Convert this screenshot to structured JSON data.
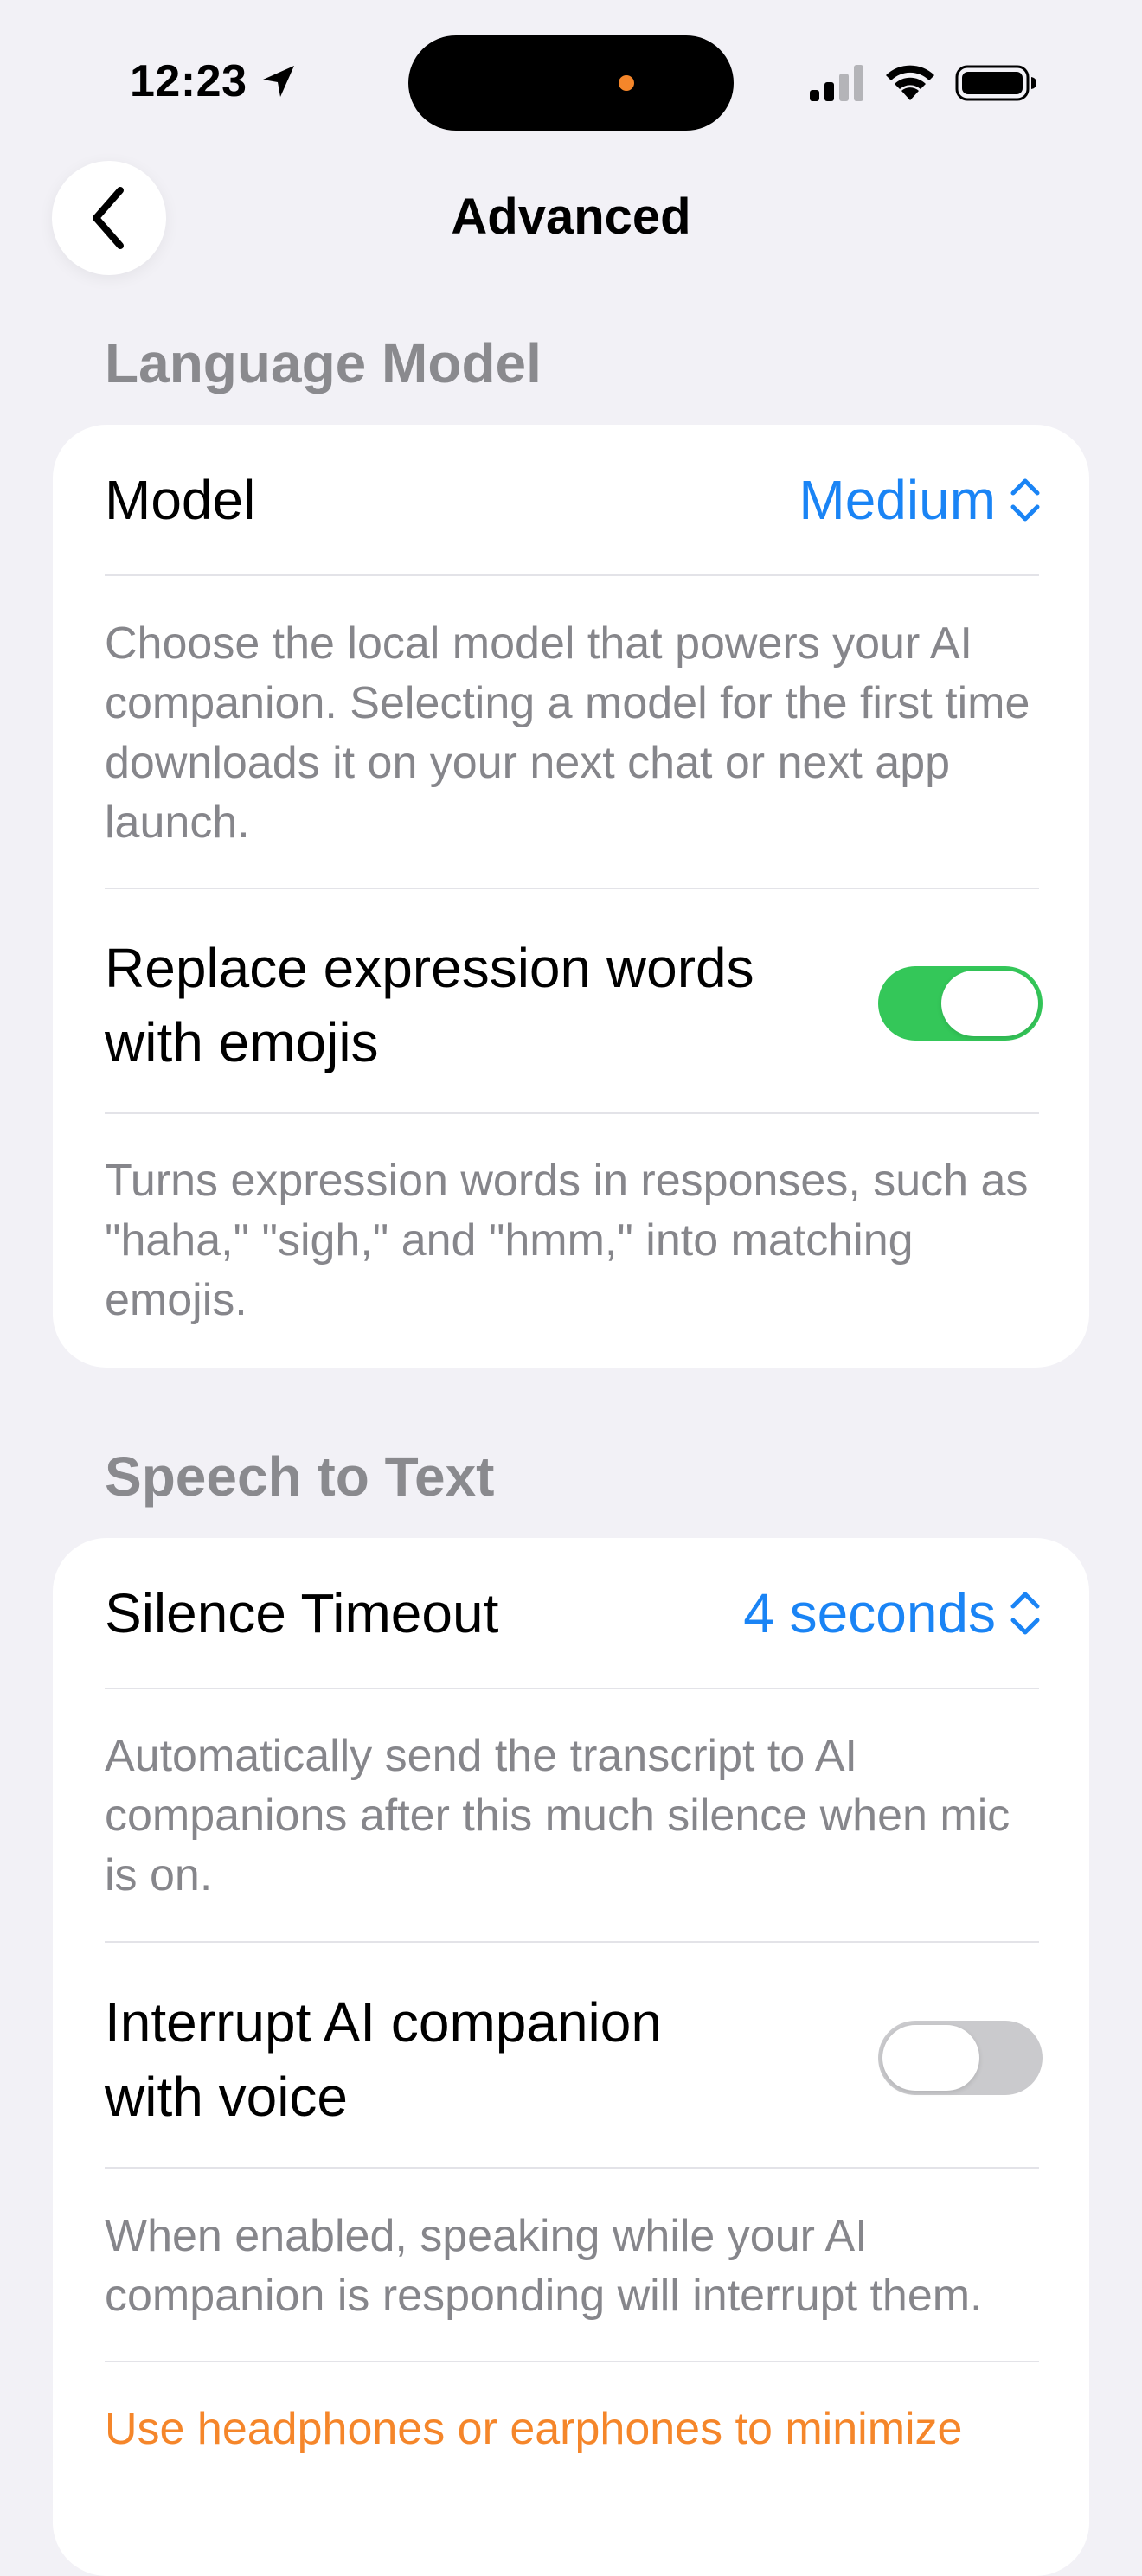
{
  "status_bar": {
    "time": "12:23"
  },
  "header": {
    "title": "Advanced"
  },
  "language_model": {
    "section_title": "Language Model",
    "model_label": "Model",
    "model_value": "Medium",
    "model_description": "Choose the local model that powers your AI companion. Selecting a model for the first time downloads it on your next chat or next app launch.",
    "emoji_label_line1": "Replace expression words",
    "emoji_label_line2": "with emojis",
    "emoji_toggle_on": true,
    "emoji_description": "Turns expression words in responses, such as \"haha,\" \"sigh,\" and \"hmm,\" into matching emojis."
  },
  "speech_to_text": {
    "section_title": "Speech to Text",
    "timeout_label": "Silence Timeout",
    "timeout_value": "4 seconds",
    "timeout_description": "Automatically send the transcript to AI companions after this much silence when mic is on.",
    "interrupt_label_line1": "Interrupt AI companion",
    "interrupt_label_line2": "with voice",
    "interrupt_toggle_on": false,
    "interrupt_description": "When enabled, speaking while your AI companion is responding will interrupt them.",
    "warning_text": "Use headphones or earphones to minimize"
  },
  "colors": {
    "accent": "#1a84f5",
    "toggle_on": "#34c759",
    "toggle_off": "#cacacd",
    "warning": "#f5862a",
    "background": "#f2f1f6"
  }
}
